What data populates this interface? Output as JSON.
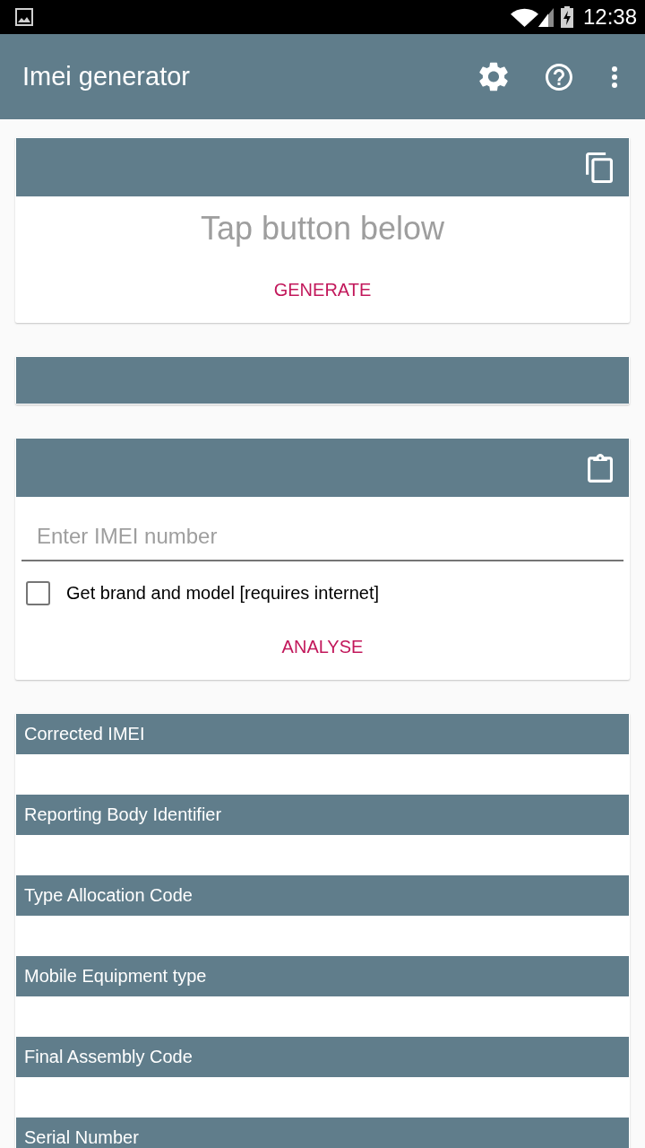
{
  "status_bar": {
    "time": "12:38"
  },
  "app_bar": {
    "title": "Imei generator"
  },
  "cards": [
    {
      "kind": "generator",
      "hint": "Tap button below",
      "button": "GENERATE"
    },
    {
      "kind": "header_only"
    },
    {
      "kind": "analyser",
      "input": {
        "placeholder": "Enter IMEI number"
      },
      "checkbox": {
        "label": "Get brand and model [requires internet]",
        "checked": false
      },
      "button": "ANALYSE"
    },
    {
      "kind": "results",
      "fields": [
        {
          "label": "Corrected IMEI"
        },
        {
          "label": "Reporting Body Identifier"
        },
        {
          "label": "Type Allocation Code"
        },
        {
          "label": "Mobile Equipment type"
        },
        {
          "label": "Final Assembly Code"
        },
        {
          "label": "Serial Number"
        }
      ]
    }
  ]
}
